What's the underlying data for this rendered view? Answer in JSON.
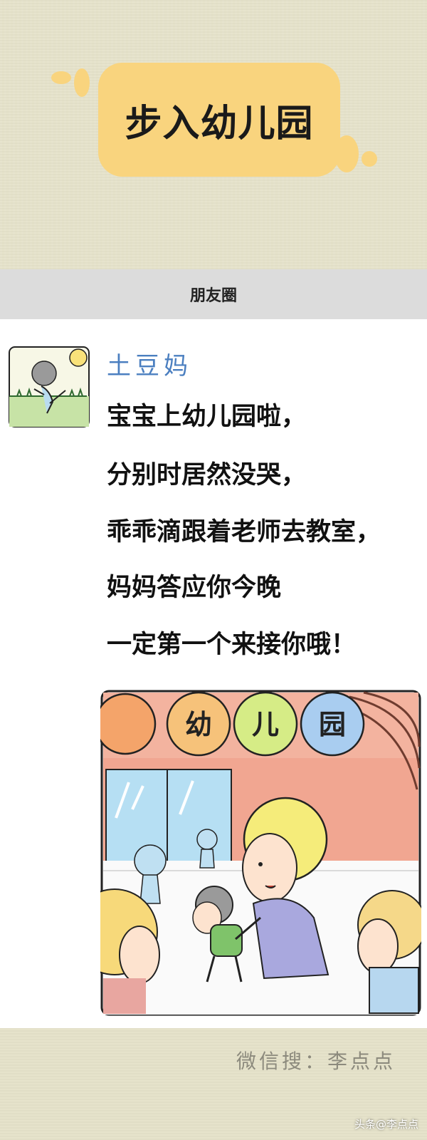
{
  "header": {
    "title": "步入幼儿园"
  },
  "moments": {
    "bar_title": "朋友圈",
    "post": {
      "author": "土豆妈",
      "lines": [
        "宝宝上幼儿园啦，",
        "分别时居然没哭，",
        "乖乖滴跟着老师去教室，",
        "妈妈答应你今晚",
        "一定第一个来接你哦！"
      ]
    },
    "comic": {
      "signs": [
        "幼",
        "儿",
        "园"
      ]
    }
  },
  "footer": {
    "wechat_search": "微信搜：李点点",
    "credit": "头条@李点点"
  },
  "colors": {
    "title_yellow": "#f9d47e",
    "author_blue": "#4b7fc0",
    "sign_orange": "#f6c27a",
    "sign_green": "#d6ec86",
    "sign_blue": "#a9cdf0"
  }
}
